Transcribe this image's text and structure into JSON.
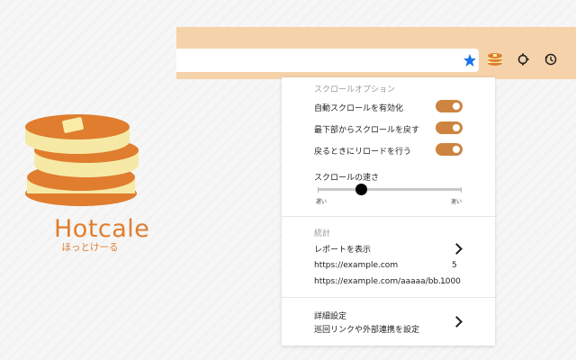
{
  "logo": {
    "title": "Hotcale",
    "subtitle": "ほっとけーる"
  },
  "browser": {
    "icons": [
      "star-icon",
      "pancake-icon",
      "puzzle-icon",
      "history-icon"
    ],
    "accent": "#f5d2aa"
  },
  "popup": {
    "scroll_options": {
      "heading": "スクロールオプション",
      "toggles": [
        {
          "label": "自動スクロールを有効化",
          "on": true
        },
        {
          "label": "最下部からスクロールを戻す",
          "on": true
        },
        {
          "label": "戻るときにリロードを行う",
          "on": true
        }
      ],
      "speed": {
        "label": "スクロールの速さ",
        "min_label": "遅い",
        "max_label": "速い",
        "value_fraction": 0.3
      }
    },
    "stats": {
      "heading": "統計",
      "report_label": "レポートを表示",
      "rows": [
        {
          "url": "https://example.com",
          "count": "5"
        },
        {
          "url": "https://example.com/aaaaa/bb...",
          "count": "1000"
        }
      ]
    },
    "advanced": {
      "title": "詳細設定",
      "desc": "巡回リンクや外部連携を設定"
    },
    "toggle_color": "#cd8440"
  }
}
